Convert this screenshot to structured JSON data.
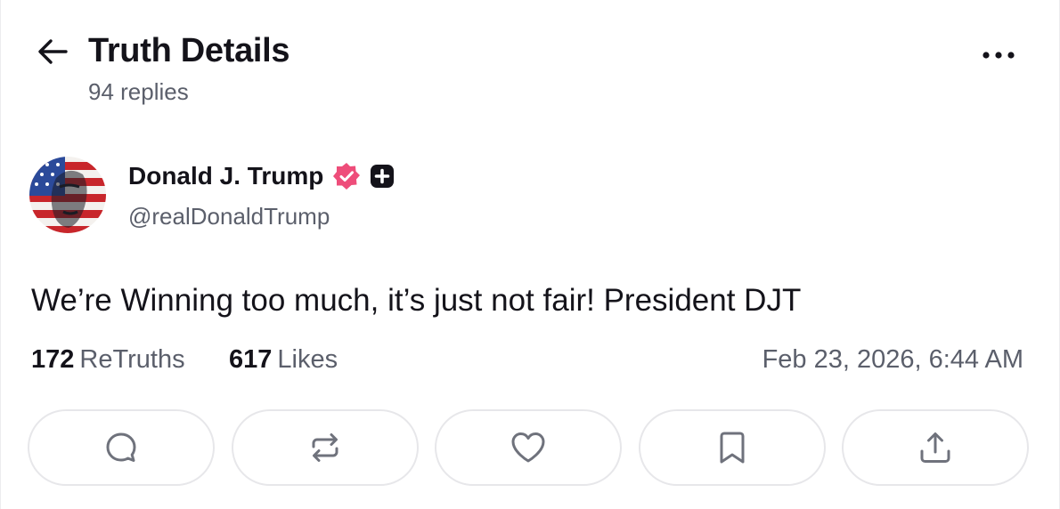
{
  "header": {
    "title": "Truth Details",
    "replies": "94 replies"
  },
  "author": {
    "display_name": "Donald J. Trump",
    "handle": "@realDonaldTrump",
    "verified_color": "#ee4d7a"
  },
  "post": {
    "text": "We’re Winning too much, it’s just not fair! President DJT"
  },
  "stats": {
    "retruths_count": "172",
    "retruths_label": "ReTruths",
    "likes_count": "617",
    "likes_label": "Likes",
    "timestamp": "Feb 23, 2026, 6:44 AM"
  },
  "actions": [
    {
      "icon": "reply-icon"
    },
    {
      "icon": "retruth-icon"
    },
    {
      "icon": "like-icon"
    },
    {
      "icon": "bookmark-icon"
    },
    {
      "icon": "share-icon"
    }
  ]
}
